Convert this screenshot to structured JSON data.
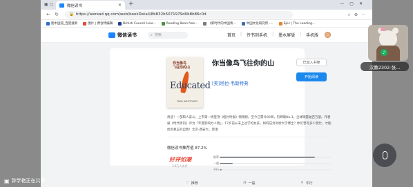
{
  "browser": {
    "tab_title": "微信读书",
    "url": "https://weread.qq.com/web/bookDetail/8b832b5071979d0b8b86c0d",
    "bookmarks": [
      {
        "label": "图中国道_百度搜索",
        "color": "#2f6bd8"
      },
      {
        "label": "图片 | 费含特编辑",
        "color": "#e34b3b"
      },
      {
        "label": "British Council Lear...",
        "color": "#1f3d8f"
      },
      {
        "label": "Reading Bean free...",
        "color": "#4a8f3a"
      },
      {
        "label": "《新时代的中国青...",
        "color": "#7a7a7a"
      },
      {
        "label": "中国文化研究所 -...",
        "color": "#3a6fb0"
      },
      {
        "label": "Epic | The Leading...",
        "color": "#e6852a"
      }
    ]
  },
  "site": {
    "logo_text": "微信读书",
    "search_placeholder": "搜索",
    "nav": [
      "首页",
      "传书到手机",
      "墨水屏版",
      "手机版"
    ]
  },
  "book": {
    "cover_title_cn": "你当像鸟\n飞往你的山",
    "cover_title_en": "Educated",
    "cover_author": "TARA WESTOVER",
    "title": "你当像鸟飞往你的山",
    "author": "[美]塔拉·韦斯特弗",
    "shelf_button": "已加入书架",
    "read_button": "开始阅读",
    "intro": "奇迹！一部和人奋斗。上市第一周登顶《纽约时报》畅销榜。至今已累计80周，仍蝉联No.1。全球销量破百万册。作者被《时代周刊》评为「年度影响力人物」。17岁前从未上过学的女孩，如何成为剑桥大学博士？你们曾有多少受忙，才能找到真正的自我！北京-西安大，累诸"
  },
  "rating": {
    "title": "微信读书推荐值 87.2%",
    "badge": "好评如潮",
    "badge_sub": "3.6万人点评",
    "rows": [
      {
        "label": "推荐",
        "percent": 86
      },
      {
        "label": "一般",
        "percent": 12
      },
      {
        "label": "不行",
        "percent": 2
      }
    ]
  },
  "actions": [
    "推荐",
    "一般",
    "不行"
  ],
  "meeting": {
    "participant_name": "汉教2302-张...",
    "share_text": "钟学艳正在共享"
  }
}
